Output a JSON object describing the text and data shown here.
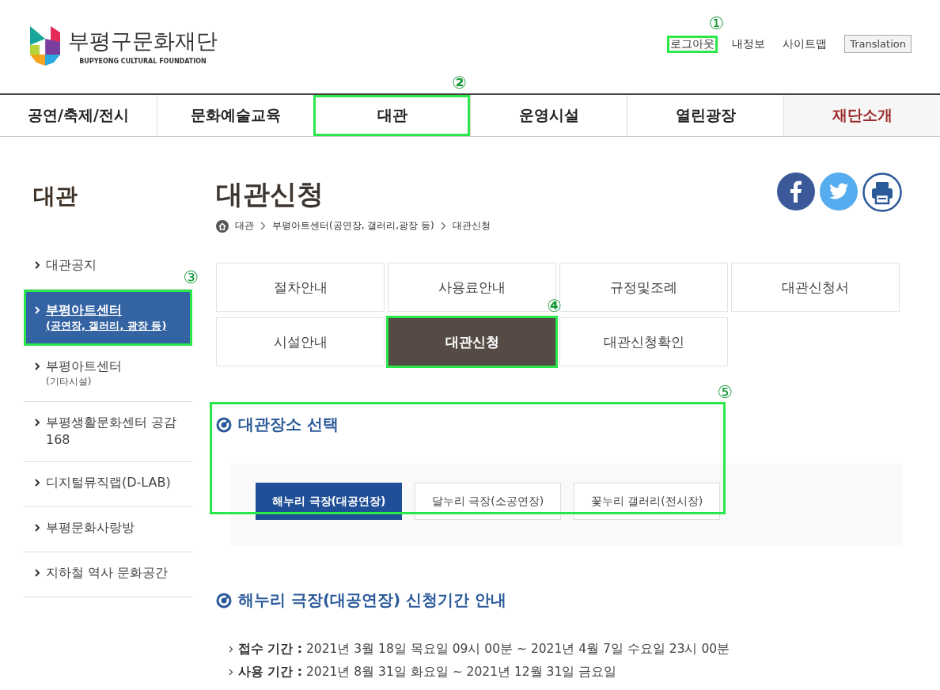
{
  "header": {
    "logo": {
      "name": "부평구문화재단",
      "subtitle": "BUPYEONG CULTURAL FOUNDATION"
    },
    "utility_links": [
      {
        "label": "로그아웃",
        "callout": "①"
      },
      {
        "label": "내정보"
      },
      {
        "label": "사이트맵"
      }
    ],
    "translation_button": "Translation"
  },
  "nav": [
    {
      "label": "공연/축제/전시",
      "selected": false
    },
    {
      "label": "문화예술교육",
      "selected": false
    },
    {
      "label": "대관",
      "selected": false,
      "callout": "②"
    },
    {
      "label": "운영시설",
      "selected": false
    },
    {
      "label": "열린광장",
      "selected": false
    },
    {
      "label": "재단소개",
      "selected": true
    }
  ],
  "sidebar": {
    "title": "대관",
    "items": [
      {
        "label": "대관공지",
        "selected": false
      },
      {
        "label": "부평아트센터",
        "sub": "(공연장, 갤러리, 광장 등)",
        "selected": true,
        "callout": "③"
      },
      {
        "label": "부평아트센터",
        "sub": "(기타시설)",
        "selected": false
      },
      {
        "label": "부평생활문화센터 공감 168",
        "selected": false
      },
      {
        "label": "디지털뮤직랩(D-LAB)",
        "selected": false
      },
      {
        "label": "부평문화사랑방",
        "selected": false
      },
      {
        "label": "지하철 역사 문화공간",
        "selected": false
      }
    ]
  },
  "page": {
    "title": "대관신청",
    "breadcrumb": [
      "대관",
      "부평아트센터(공연장, 갤러리,광장 등)",
      "대관신청"
    ],
    "share": [
      {
        "kind": "facebook"
      },
      {
        "kind": "twitter"
      },
      {
        "kind": "print"
      }
    ]
  },
  "tabs": [
    {
      "label": "절차안내",
      "selected": false
    },
    {
      "label": "사용료안내",
      "selected": false
    },
    {
      "label": "규정및조례",
      "selected": false
    },
    {
      "label": "대관신청서",
      "selected": false
    },
    {
      "label": "시설안내",
      "selected": false
    },
    {
      "label": "대관신청",
      "selected": true,
      "callout": "④"
    },
    {
      "label": "대관신청확인",
      "selected": false
    }
  ],
  "venue_section": {
    "title": "대관장소 선택",
    "callout": "⑤",
    "venues": [
      {
        "label": "해누리 극장(대공연장)",
        "selected": true
      },
      {
        "label": "달누리 극장(소공연장)",
        "selected": false
      },
      {
        "label": "꽃누리 갤러리(전시장)",
        "selected": false
      }
    ]
  },
  "period_section": {
    "title": "해누리 극장(대공연장) 신청기간 안내",
    "lines": [
      {
        "label": "접수 기간 :",
        "value": "2021년 3월 18일 목요일 09시 00분 ~ 2021년 4월 7일 수요일 23시 00분"
      },
      {
        "label": "사용 기간 :",
        "value": "2021년 8월 31일 화요일 ~ 2021년 12월 31일 금요일"
      }
    ]
  }
}
